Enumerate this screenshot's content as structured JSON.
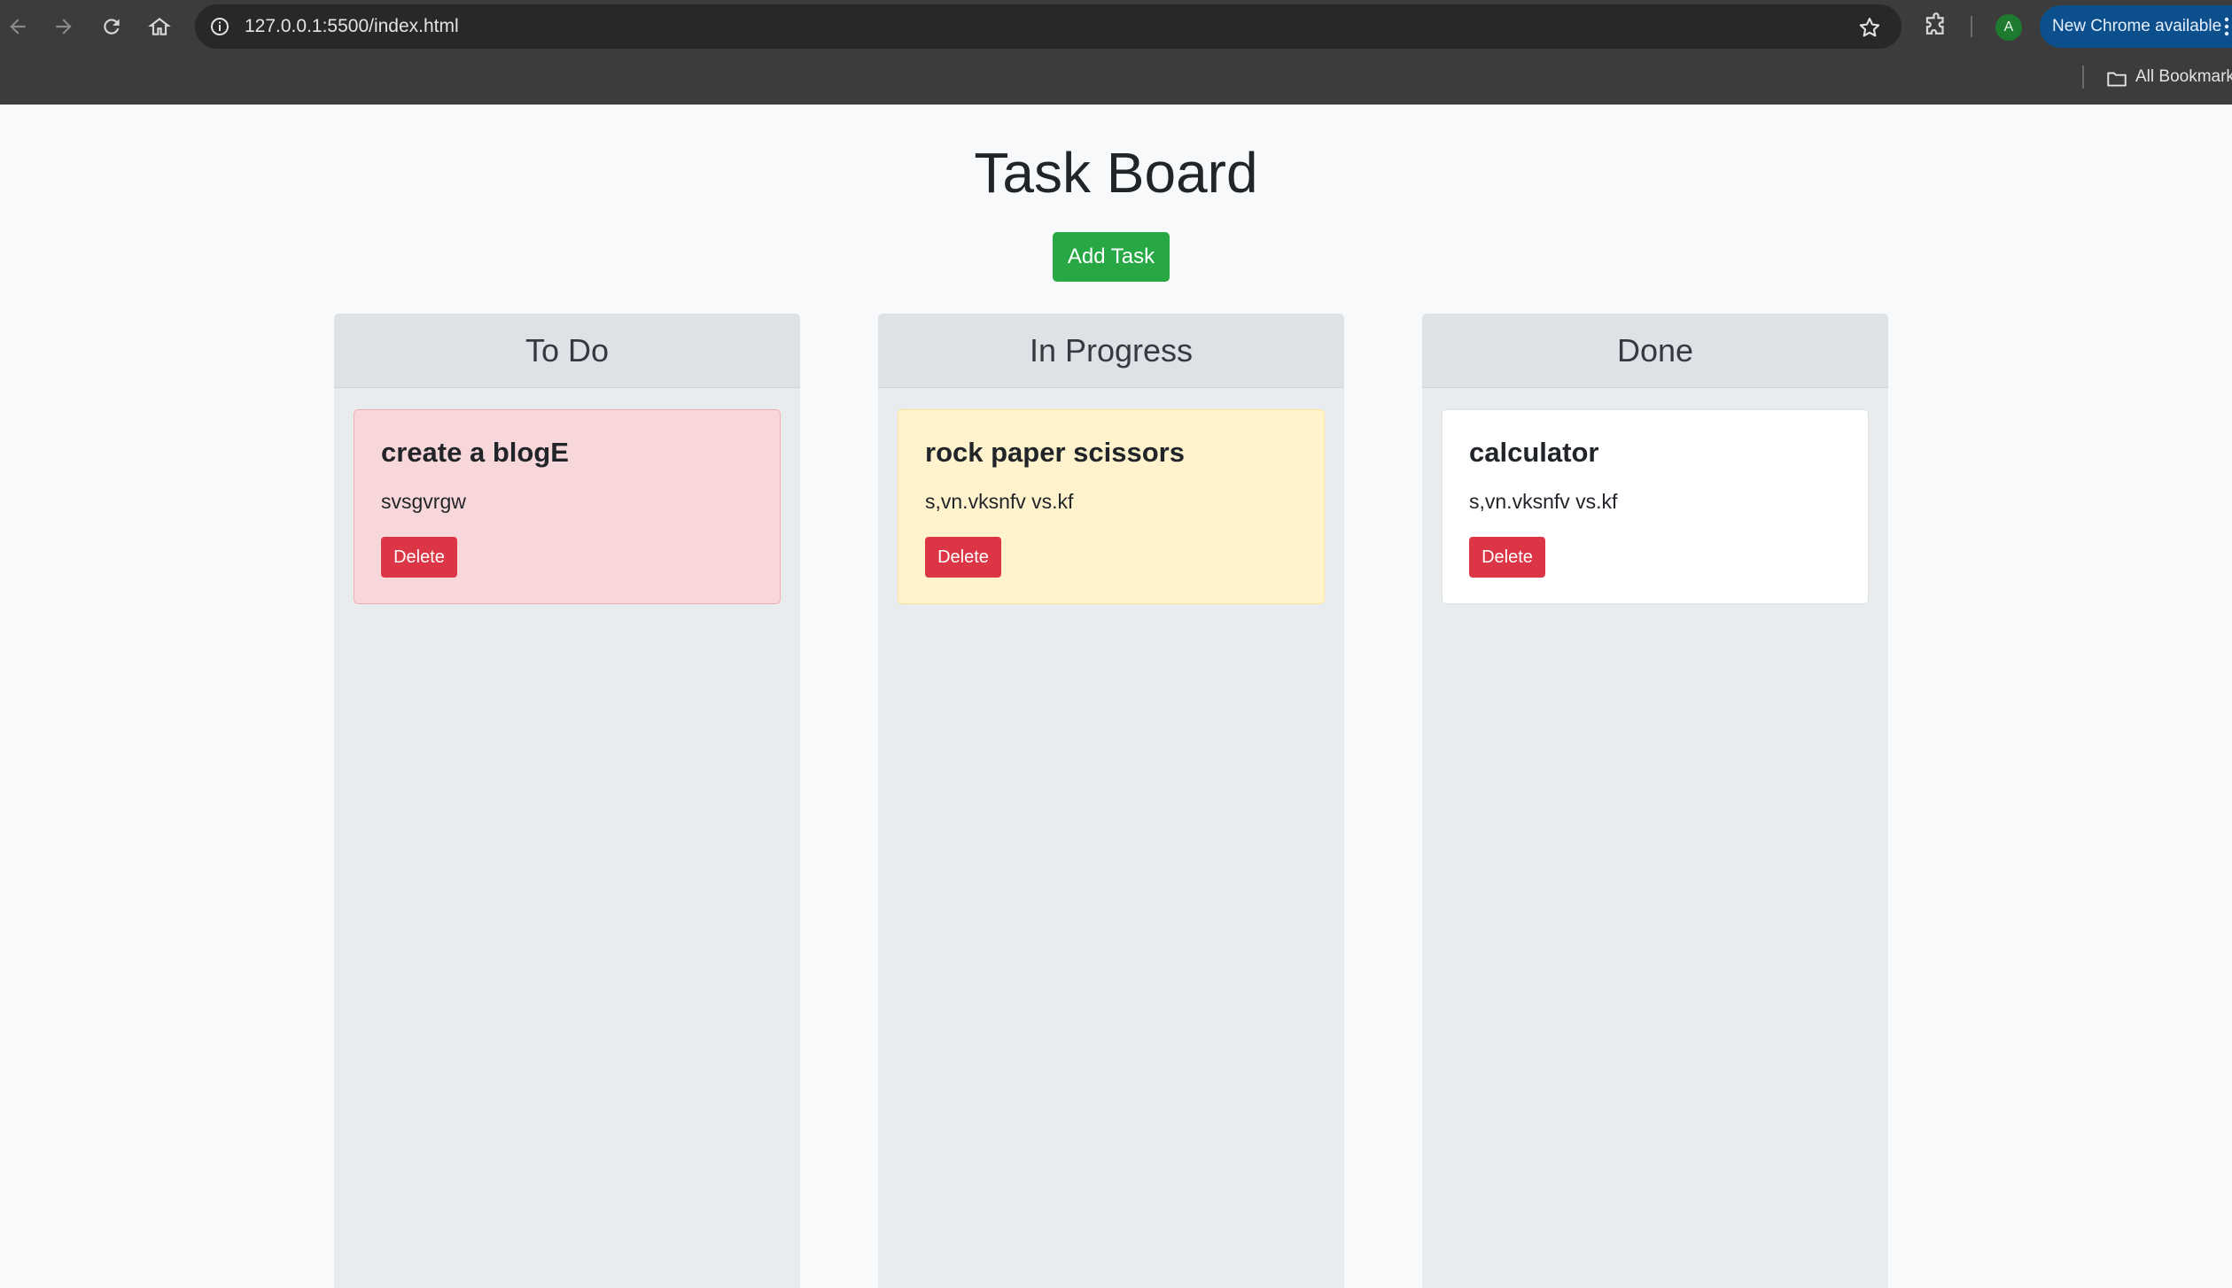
{
  "browser": {
    "url": "127.0.0.1:5500/index.html",
    "update_label": "New Chrome available",
    "avatar_letter": "A",
    "bookmarks_label": "All Bookmarks"
  },
  "page": {
    "title": "Task Board",
    "add_task_label": "Add Task"
  },
  "columns": [
    {
      "title": "To Do",
      "tasks": [
        {
          "title": "create a blogE",
          "description": "svsgvrgw",
          "delete_label": "Delete",
          "color": "#f8d7da"
        }
      ]
    },
    {
      "title": "In Progress",
      "tasks": [
        {
          "title": "rock paper scissors",
          "description": "s,vn.vksnfv vs.kf",
          "delete_label": "Delete",
          "color": "#fff3cd"
        }
      ]
    },
    {
      "title": "Done",
      "tasks": [
        {
          "title": "calculator",
          "description": "s,vn.vksnfv vs.kf",
          "delete_label": "Delete",
          "color": "#ffffff"
        }
      ]
    }
  ],
  "colors": {
    "add_button": "#28a745",
    "delete_button": "#dc3545",
    "update_pill": "#0b4f8c"
  }
}
